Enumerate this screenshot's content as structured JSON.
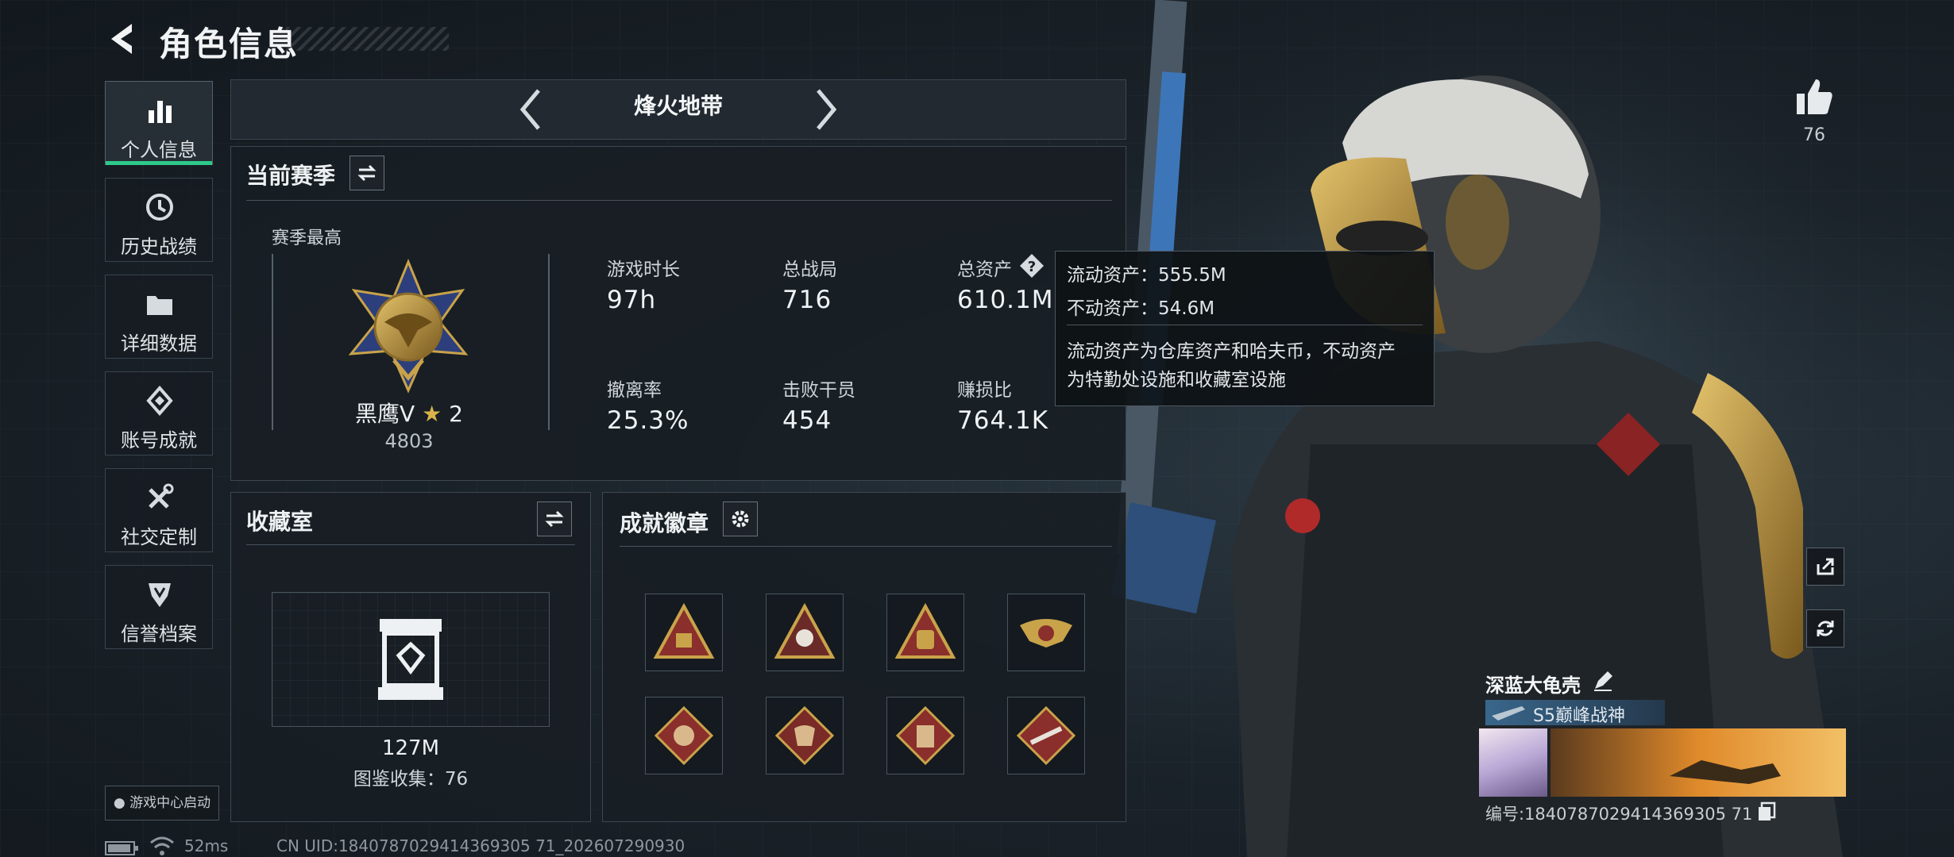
{
  "header": {
    "title": "角色信息"
  },
  "sidebar": {
    "items": [
      {
        "label": "个人信息",
        "icon": "bar-chart-icon",
        "active": true
      },
      {
        "label": "历史战绩",
        "icon": "history-clock-icon"
      },
      {
        "label": "详细数据",
        "icon": "folder-icon"
      },
      {
        "label": "账号成就",
        "icon": "achievement-diamond-icon"
      },
      {
        "label": "社交定制",
        "icon": "tools-icon"
      },
      {
        "label": "信誉档案",
        "icon": "shield-badge-icon"
      }
    ],
    "game_center": "游戏中心启动"
  },
  "mode": {
    "name": "烽火地带"
  },
  "season": {
    "title": "当前赛季",
    "best_label": "赛季最高",
    "rank_name": "黑鹰V",
    "rank_stars": "2",
    "rank_points": "4803",
    "stats": [
      {
        "label": "游戏时长",
        "value": "97h"
      },
      {
        "label": "总战局",
        "value": "716"
      },
      {
        "label": "总资产",
        "value": "610.1M"
      },
      {
        "label": "撤离率",
        "value": "25.3%"
      },
      {
        "label": "击败干员",
        "value": "454"
      },
      {
        "label": "赚损比",
        "value": "764.1K"
      }
    ]
  },
  "tooltip": {
    "line1": "流动资产：555.5M",
    "line2": "不动资产：54.6M",
    "desc1": "流动资产为仓库资产和哈夫币，不动资产",
    "desc2": "为特勤处设施和收藏室设施"
  },
  "collection": {
    "title": "收藏室",
    "value": "127M",
    "catalog": "图鉴收集：76"
  },
  "badges": {
    "title": "成就徽章",
    "items": [
      "badge-triangle-s8-icon",
      "badge-triangle-skull-icon",
      "badge-triangle-bag-icon",
      "badge-wings-icon",
      "badge-diamond-wolf-icon",
      "badge-diamond-dragon-icon",
      "badge-diamond-vest-icon",
      "badge-diamond-rifle-icon"
    ]
  },
  "status_bar": {
    "ping": "52ms",
    "uid": "CN UID:1840787029414369305 71_202607290930"
  },
  "player": {
    "likes": "76",
    "name": "深蓝大龟壳",
    "title": "S5巅峰战神",
    "id": "编号:1840787029414369305 71"
  },
  "colors": {
    "accent": "#2ec98a",
    "panel_bg": "#181e24",
    "gold": "#c9a34a",
    "badge_red": "#8a2f2b"
  }
}
